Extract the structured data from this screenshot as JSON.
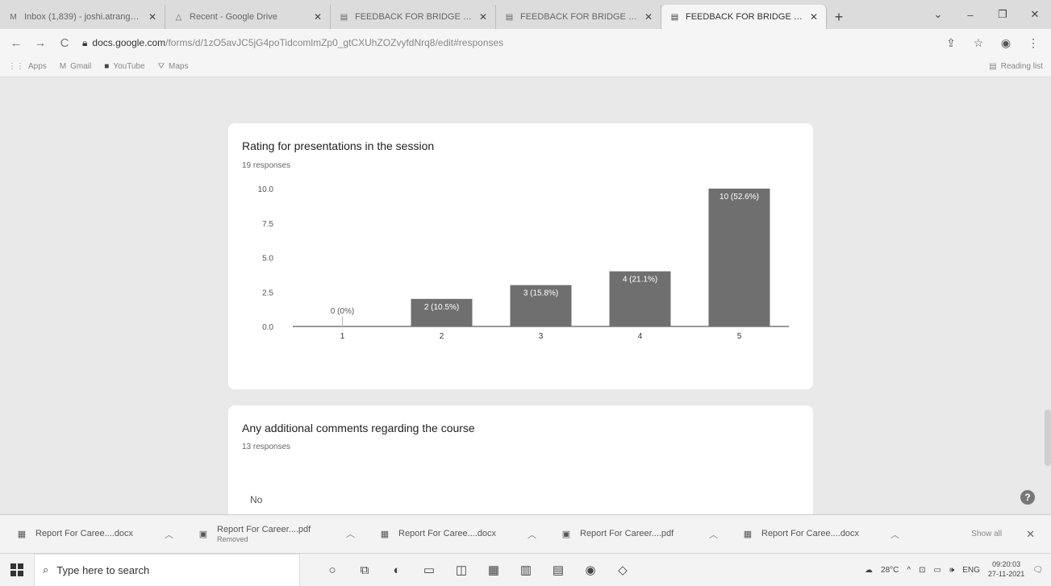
{
  "browser": {
    "tabs": [
      {
        "icon": "gmail-icon",
        "title": "Inbox (1,839) - joshi.atrang@...",
        "active": false
      },
      {
        "icon": "drive-icon",
        "title": "Recent - Google Drive",
        "active": false
      },
      {
        "icon": "forms-icon",
        "title": "FEEDBACK FOR BRIDGE COU",
        "active": false
      },
      {
        "icon": "forms-icon",
        "title": "FEEDBACK FOR BRIDGE COU",
        "active": false
      },
      {
        "icon": "forms-icon",
        "title": "FEEDBACK FOR BRIDGE COU",
        "active": true
      }
    ],
    "url_host": "docs.google.com",
    "url_path": "/forms/d/1zO5avJC5jG4poTidcomlmZp0_gtCXUhZOZvyfdNrq8/edit#responses",
    "bookmarks": [
      {
        "icon": "apps-icon",
        "label": "Apps"
      },
      {
        "icon": "gmail-icon",
        "label": "Gmail"
      },
      {
        "icon": "youtube-icon",
        "label": "YouTube"
      },
      {
        "icon": "maps-icon",
        "label": "Maps"
      }
    ],
    "reading_list": "Reading list"
  },
  "question1": {
    "title": "Rating for presentations in the session",
    "responses": "19 responses"
  },
  "chart_data": {
    "type": "bar",
    "categories": [
      "1",
      "2",
      "3",
      "4",
      "5"
    ],
    "values": [
      0,
      2,
      3,
      4,
      10
    ],
    "data_labels": [
      "0 (0%)",
      "2 (10.5%)",
      "3 (15.8%)",
      "4 (21.1%)",
      "10 (52.6%)"
    ],
    "yticks": [
      "0.0",
      "2.5",
      "5.0",
      "7.5",
      "10.0"
    ],
    "ylim": [
      0,
      10
    ],
    "bar_color": "#6f6f6f"
  },
  "question2": {
    "title": "Any additional comments regarding the course",
    "responses": "13 responses",
    "first_answer": "No"
  },
  "downloads": {
    "items": [
      {
        "icon": "word-doc-icon",
        "name": "Report For Caree....docx",
        "sub": ""
      },
      {
        "icon": "pdf-icon",
        "name": "Report For Career....pdf",
        "sub": "Removed"
      },
      {
        "icon": "word-doc-icon",
        "name": "Report For Caree....docx",
        "sub": ""
      },
      {
        "icon": "pdf-icon",
        "name": "Report For Career....pdf",
        "sub": ""
      },
      {
        "icon": "word-doc-icon",
        "name": "Report For Caree....docx",
        "sub": ""
      }
    ],
    "show_all": "Show all"
  },
  "taskbar": {
    "search_placeholder": "Type here to search",
    "temperature": "28°C",
    "language": "ENG",
    "time": "09:20:03",
    "date": "27-11-2021"
  }
}
